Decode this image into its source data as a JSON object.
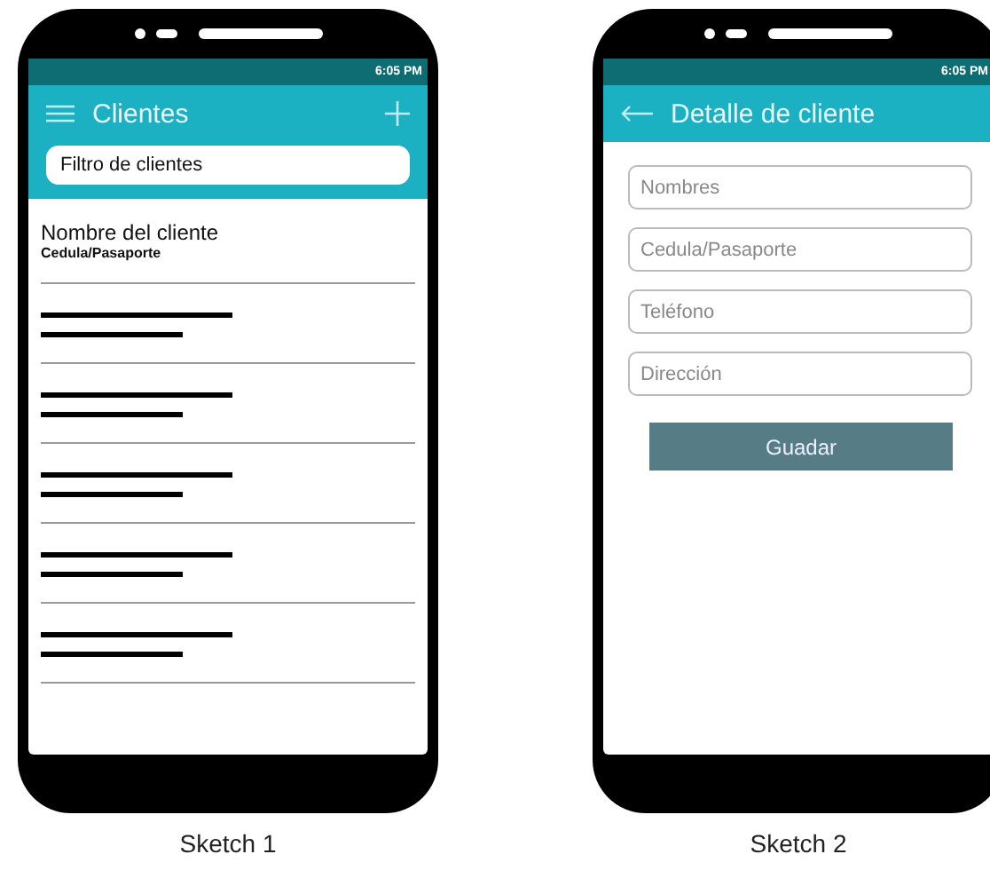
{
  "sketches": [
    {
      "caption": "Sketch 1",
      "screen": {
        "kind": "list",
        "status_time": "6:05 PM",
        "title": "Clientes",
        "menu_button": true,
        "add_button": true,
        "filter": {
          "placeholder": "Filtro de clientes"
        },
        "items": [
          {
            "kind": "text",
            "name": "Nombre del cliente",
            "detail": "Cedula/Pasaporte"
          },
          {
            "kind": "placeholder"
          },
          {
            "kind": "placeholder"
          },
          {
            "kind": "placeholder"
          },
          {
            "kind": "placeholder"
          },
          {
            "kind": "placeholder"
          }
        ]
      }
    },
    {
      "caption": "Sketch 2",
      "screen": {
        "kind": "form",
        "status_time": "6:05 PM",
        "title": "Detalle de cliente",
        "back_button": true,
        "fields": [
          {
            "placeholder": "Nombres"
          },
          {
            "placeholder": "Cedula/Pasaporte"
          },
          {
            "placeholder": "Teléfono"
          },
          {
            "placeholder": "Dirección"
          }
        ],
        "button": "Guadar"
      }
    }
  ]
}
